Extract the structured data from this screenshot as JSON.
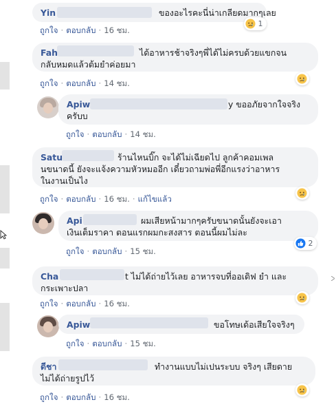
{
  "comments": [
    {
      "name": "Yin",
      "text_lines": [
        "ของอะไรคะนี่น่าเกลียดมากๆเลย"
      ],
      "like": "ถูกใจ",
      "reply": "ตอบกลับ",
      "time": "16 ชม.",
      "reaction": {
        "icon": "sad-icon",
        "count": "1"
      }
    },
    {
      "name": "Fah",
      "text_lines": [
        "ได้อาหารช้าจริงๆพี่ได้ไม่ครบด้วยแขกจน",
        "กลับหมดแล้วต้มยำค่อยมา"
      ],
      "like": "ถูกใจ",
      "reply": "ตอบกลับ",
      "time": "14 ชม.",
      "reaction": {
        "icon": "sad-icon",
        "count": ""
      }
    },
    {
      "name": "Apiw",
      "text_lines": [
        "y ขออภัยจากใจจริง",
        "ครับบ"
      ],
      "like": "ถูกใจ",
      "reply": "ตอบกลับ",
      "time": "14 ชม."
    },
    {
      "name": "Satu",
      "text_lines": [
        "ร้านไหนบิ๊ก จะได้ไม่เฉียดไป ลูกค้าคอมเพล",
        "นขนาดนี้ ยังจะแจ้งความหัวหมออีก เดี๋ยวถามพ่อพี่อีกแรงว่าอาหาร",
        "ในงานเป็นไง"
      ],
      "like": "ถูกใจ",
      "reply": "ตอบกลับ",
      "time": "16 ชม.",
      "edited": "แก้ไขแล้ว",
      "reaction": {
        "icon": "sad-icon",
        "count": ""
      }
    },
    {
      "name": "Api",
      "text_lines": [
        "ผมเสียหน้ามากๆครับขนาดนั้นยังจะเอา",
        "เงินเต็มราคา ตอนแรกผมกะสงสาร ตอนนี้ผมไม่ละ"
      ],
      "like": "ถูกใจ",
      "reply": "ตอบกลับ",
      "time": "15 ชม.",
      "reaction": {
        "icon": "like-icon",
        "count": "2"
      }
    },
    {
      "name": "Cha",
      "text_lines": [
        "t ไม่ได้ถ่ายไว้เลย อาหารจบที่ออเดิฟ ยำ และ",
        "กระเพาะปลา"
      ],
      "like": "ถูกใจ",
      "reply": "ตอบกลับ",
      "time": "16 ชม.",
      "reaction": {
        "icon": "sad-icon",
        "count": ""
      }
    },
    {
      "name": "Apiw",
      "text_lines": [
        "ขอโทษเด้อเสียใจจริงๆ"
      ],
      "like": "ถูกใจ",
      "reply": "ตอบกลับ",
      "time": "15 ชม."
    },
    {
      "name": "ดีชา",
      "text_lines": [
        "ทำงานแบบไม่เปนระบบ จริงๆ เสียดาย",
        "ไม่ได้ถ่ายรูปไว้"
      ],
      "like": "ถูกใจ",
      "reply": "ตอบกลับ",
      "time": "16 ชม.",
      "reaction": {
        "icon": "sad-icon",
        "count": ""
      }
    }
  ],
  "colors": {
    "name": "#385898",
    "bubble": "#f2f3f5",
    "sad_face": "#f7c44a",
    "like_badge": "#1877f2"
  }
}
